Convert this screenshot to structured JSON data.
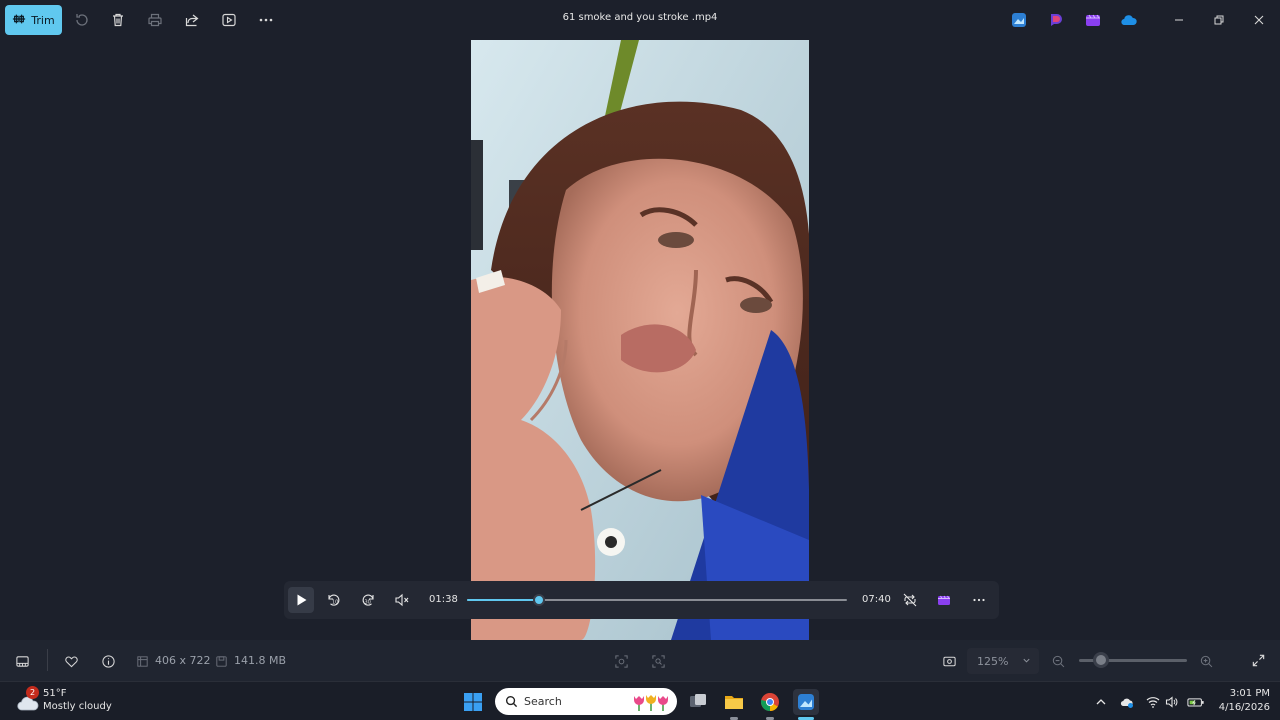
{
  "titlebar": {
    "trim_label": "Trim",
    "title": "61 smoke and you stroke .mp4"
  },
  "player": {
    "current_time": "01:38",
    "total_time": "07:40",
    "progress": 0.19
  },
  "statusbar": {
    "dimensions": "406 x 722",
    "file_size": "141.8 MB",
    "zoom": "125%",
    "zoom_slider_level": 0.2
  },
  "taskbar": {
    "weather_badge": "2",
    "temperature": "51°F",
    "condition": "Mostly cloudy",
    "search_label": "Search",
    "time": "3:01 PM",
    "date": "4/16/2026"
  },
  "colors": {
    "accent": "#60c8ef",
    "background": "#1c202b"
  }
}
